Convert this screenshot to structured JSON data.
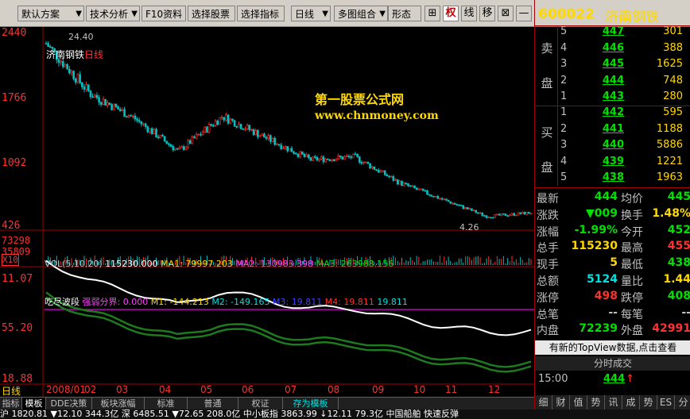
{
  "toolbar": {
    "scheme": "默认方案",
    "tech": "技术分析",
    "f10": "F10资料",
    "pick_stock": "选择股票",
    "pick_indicator": "选择指标",
    "period": "日线",
    "multi_chart": "多图组合",
    "shape": "形态",
    "icon_plus": "⊞",
    "icon_quan": "权",
    "icon_line": "线",
    "icon_move": "移",
    "icon_x": "⊠",
    "icon_min": "—"
  },
  "chart": {
    "stock_label": "济南钢铁",
    "timeframe": "日线",
    "high_label": "24.40",
    "low_label": "4.26",
    "y_labels": [
      "2440",
      "1766",
      "1092",
      "426"
    ],
    "vol_labels": [
      "73298",
      "35809",
      "X10"
    ],
    "ind_labels": [
      "11.07",
      "55.20",
      "18.88"
    ],
    "watermark_1": "第一股票公式网",
    "watermark_2": "www.chnmoney.com",
    "vol_title": "VOL(5,10,20)",
    "vol_value": "115230.000",
    "vol_ma1": "MA1: 79997.203",
    "vol_ma2": "MA2: 130983.398",
    "vol_ma3": "MA3: 263988.156",
    "ind_title": "吃尽波段",
    "ind_a": "强弱分界: 0.000",
    "ind_m1": "M1: -144.213",
    "ind_m2": "M2: -149.165",
    "ind_m3": "M3: 19.811",
    "ind_m4": "M4: 19.811",
    "ind_extra": "19.811",
    "bottom_label": "日线",
    "x_labels": [
      "2008/01",
      "02",
      "03",
      "04",
      "05",
      "06",
      "07",
      "08",
      "09",
      "10",
      "11",
      "12"
    ],
    "colors": {
      "up": "#ff3030",
      "down": "#00c0c0",
      "axis": "#a00000",
      "ma1": "#ffd800",
      "ma2": "#ff40ff",
      "ma3": "#00e000"
    }
  },
  "chart_data": {
    "type": "line",
    "title": "济南钢铁 日线",
    "xlabel": "",
    "ylabel": "",
    "x": [
      "2008/01",
      "02",
      "03",
      "04",
      "05",
      "06",
      "07",
      "08",
      "09",
      "10",
      "11",
      "12"
    ],
    "series": [
      {
        "values": [
          23.5,
          18.2,
          15.6,
          12.1,
          15.8,
          13.5,
          11.2,
          11.5,
          8.8,
          7.0,
          5.2,
          5.6
        ]
      }
    ],
    "ylim": [
      4.26,
      24.4
    ]
  },
  "bottom_tabs": [
    "指标",
    "模板",
    "DDE决策",
    "板块涨幅",
    "标准",
    "普通",
    "权证",
    "存为模板"
  ],
  "quote": {
    "code": "600022",
    "name": "济南钢铁",
    "sell_side": [
      "卖",
      "盘"
    ],
    "buy_side": [
      "买",
      "盘"
    ],
    "sell": [
      {
        "level": "5",
        "price": "447",
        "vol": "301"
      },
      {
        "level": "4",
        "price": "446",
        "vol": "388"
      },
      {
        "level": "3",
        "price": "445",
        "vol": "1625"
      },
      {
        "level": "2",
        "price": "444",
        "vol": "748"
      },
      {
        "level": "1",
        "price": "443",
        "vol": "280"
      }
    ],
    "buy": [
      {
        "level": "1",
        "price": "442",
        "vol": "595"
      },
      {
        "level": "2",
        "price": "441",
        "vol": "1188"
      },
      {
        "level": "3",
        "price": "440",
        "vol": "5886"
      },
      {
        "level": "4",
        "price": "439",
        "vol": "1221"
      },
      {
        "level": "5",
        "price": "438",
        "vol": "1963"
      }
    ],
    "stats": [
      {
        "k": "最新",
        "v": "444",
        "vc": "#00e000",
        "k2": "均价",
        "v2": "445",
        "v2c": "#00e000"
      },
      {
        "k": "涨跌",
        "v": "▼009",
        "vc": "#00e000",
        "k2": "换手",
        "v2": "1.48%",
        "v2c": "#ffd800"
      },
      {
        "k": "涨幅",
        "v": "-1.99%",
        "vc": "#00e000",
        "k2": "今开",
        "v2": "452",
        "v2c": "#00e000"
      },
      {
        "k": "总手",
        "v": "115230",
        "vc": "#ffd800",
        "k2": "最高",
        "v2": "455",
        "v2c": "#ff3030"
      },
      {
        "k": "现手",
        "v": "5",
        "vc": "#ffd800",
        "k2": "最低",
        "v2": "438",
        "v2c": "#00e000"
      },
      {
        "k": "总额",
        "v": "5124",
        "vc": "#00e0e0",
        "k2": "量比",
        "v2": "1.44",
        "v2c": "#ffd800"
      },
      {
        "k": "涨停",
        "v": "498",
        "vc": "#ff3030",
        "k2": "跌停",
        "v2": "408",
        "v2c": "#00e000"
      },
      {
        "k": "总笔",
        "v": "--",
        "vc": "#c0c0c0",
        "k2": "每笔",
        "v2": "--",
        "v2c": "#c0c0c0"
      },
      {
        "k": "内盘",
        "v": "72239",
        "vc": "#00e000",
        "k2": "外盘",
        "v2": "42991",
        "v2c": "#ff3030"
      }
    ],
    "topview": "有新的TopView数据,点击查看",
    "fenbi": "分时成交",
    "fb_time": "15:00",
    "fb_price": "444",
    "fb_arrow": "↑",
    "right_tabs": [
      "细",
      "财",
      "值",
      "势",
      "讯",
      "成",
      "势",
      "ES",
      "分"
    ]
  },
  "status": "沪 1820.81 ▼12.10 344.3亿 深 6485.51 ▼72.65 208.0亿 中小板指 3863.99 ↓12.11 79.3亿 中国船舶 快速反弹"
}
